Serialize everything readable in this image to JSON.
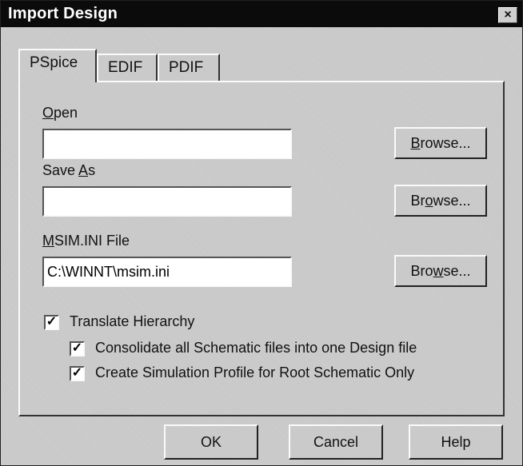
{
  "window": {
    "title": "Import Design",
    "close_glyph": "×"
  },
  "tabs": [
    {
      "label": "PSpice",
      "active": true
    },
    {
      "label": "EDIF",
      "active": false
    },
    {
      "label": "PDIF",
      "active": false
    }
  ],
  "fields": {
    "open": {
      "label_mnemonic": "O",
      "label_rest": "pen",
      "value": "",
      "browse_pre": "",
      "browse_mnemonic": "B",
      "browse_post": "rowse..."
    },
    "save_as": {
      "label_pre": "Save ",
      "label_mnemonic": "A",
      "label_rest": "s",
      "value": "",
      "browse_pre": "Br",
      "browse_mnemonic": "o",
      "browse_post": "wse..."
    },
    "msim": {
      "label_mnemonic": "M",
      "label_rest": "SIM.INI File",
      "value": "C:\\WINNT\\msim.ini",
      "browse_pre": "Bro",
      "browse_mnemonic": "w",
      "browse_post": "se..."
    }
  },
  "checkboxes": {
    "translate_hierarchy": {
      "label": "Translate Hierarchy",
      "checked": true,
      "glyph": "✓"
    },
    "consolidate": {
      "label": "Consolidate all Schematic files into one Design file",
      "checked": true,
      "glyph": "✓"
    },
    "simulation_profile": {
      "label": "Create Simulation Profile for Root Schematic Only",
      "checked": true,
      "glyph": "✓"
    }
  },
  "buttons": {
    "ok": "OK",
    "cancel": "Cancel",
    "help": "Help"
  }
}
